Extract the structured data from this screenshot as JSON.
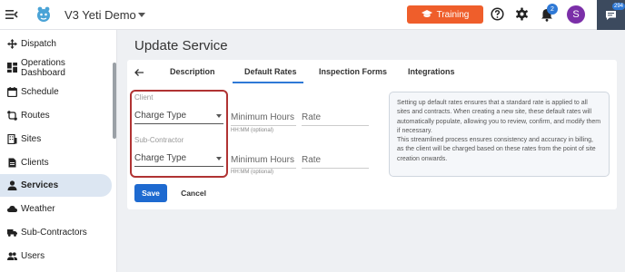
{
  "header": {
    "app_title": "V3 Yeti Demo",
    "training_label": "Training",
    "notification_count": "2",
    "avatar_initial": "S",
    "chat_count": "294",
    "accent": "#ef5e2b",
    "avatar_color": "#7b2fa8"
  },
  "sidebar": {
    "items": [
      {
        "label": "Dispatch",
        "icon": "move-icon"
      },
      {
        "label": "Operations Dashboard",
        "icon": "dashboard-icon"
      },
      {
        "label": "Schedule",
        "icon": "calendar-icon"
      },
      {
        "label": "Routes",
        "icon": "routes-icon"
      },
      {
        "label": "Sites",
        "icon": "building-icon"
      },
      {
        "label": "Clients",
        "icon": "document-icon"
      },
      {
        "label": "Services",
        "icon": "person-icon",
        "active": true
      },
      {
        "label": "Weather",
        "icon": "cloud-icon"
      },
      {
        "label": "Sub-Contractors",
        "icon": "truck-icon"
      },
      {
        "label": "Users",
        "icon": "users-icon"
      }
    ]
  },
  "page": {
    "title": "Update Service",
    "tabs": [
      {
        "label": "Description"
      },
      {
        "label": "Default Rates",
        "active": true
      },
      {
        "label": "Inspection Forms"
      },
      {
        "label": "Integrations"
      }
    ]
  },
  "form": {
    "client": {
      "caption": "Client",
      "charge_type": "Charge Type",
      "min_hours_placeholder": "Minimum Hours",
      "min_hours_hint": "HH:MM (optional)",
      "rate_placeholder": "Rate"
    },
    "subcontractor": {
      "caption": "Sub-Contractor",
      "charge_type": "Charge Type",
      "min_hours_placeholder": "Minimum Hours",
      "min_hours_hint": "HH:MM (optional)",
      "rate_placeholder": "Rate"
    },
    "info": {
      "paragraph1": "Setting up default rates ensures that a standard rate is applied to all sites and contracts. When creating a new site, these default rates will automatically populate, allowing you to review, confirm, and modify them if necessary.",
      "paragraph2": "This streamlined process ensures consistency and accuracy in billing, as the client will be charged based on these rates from the point of site creation onwards."
    },
    "save_label": "Save",
    "cancel_label": "Cancel"
  }
}
